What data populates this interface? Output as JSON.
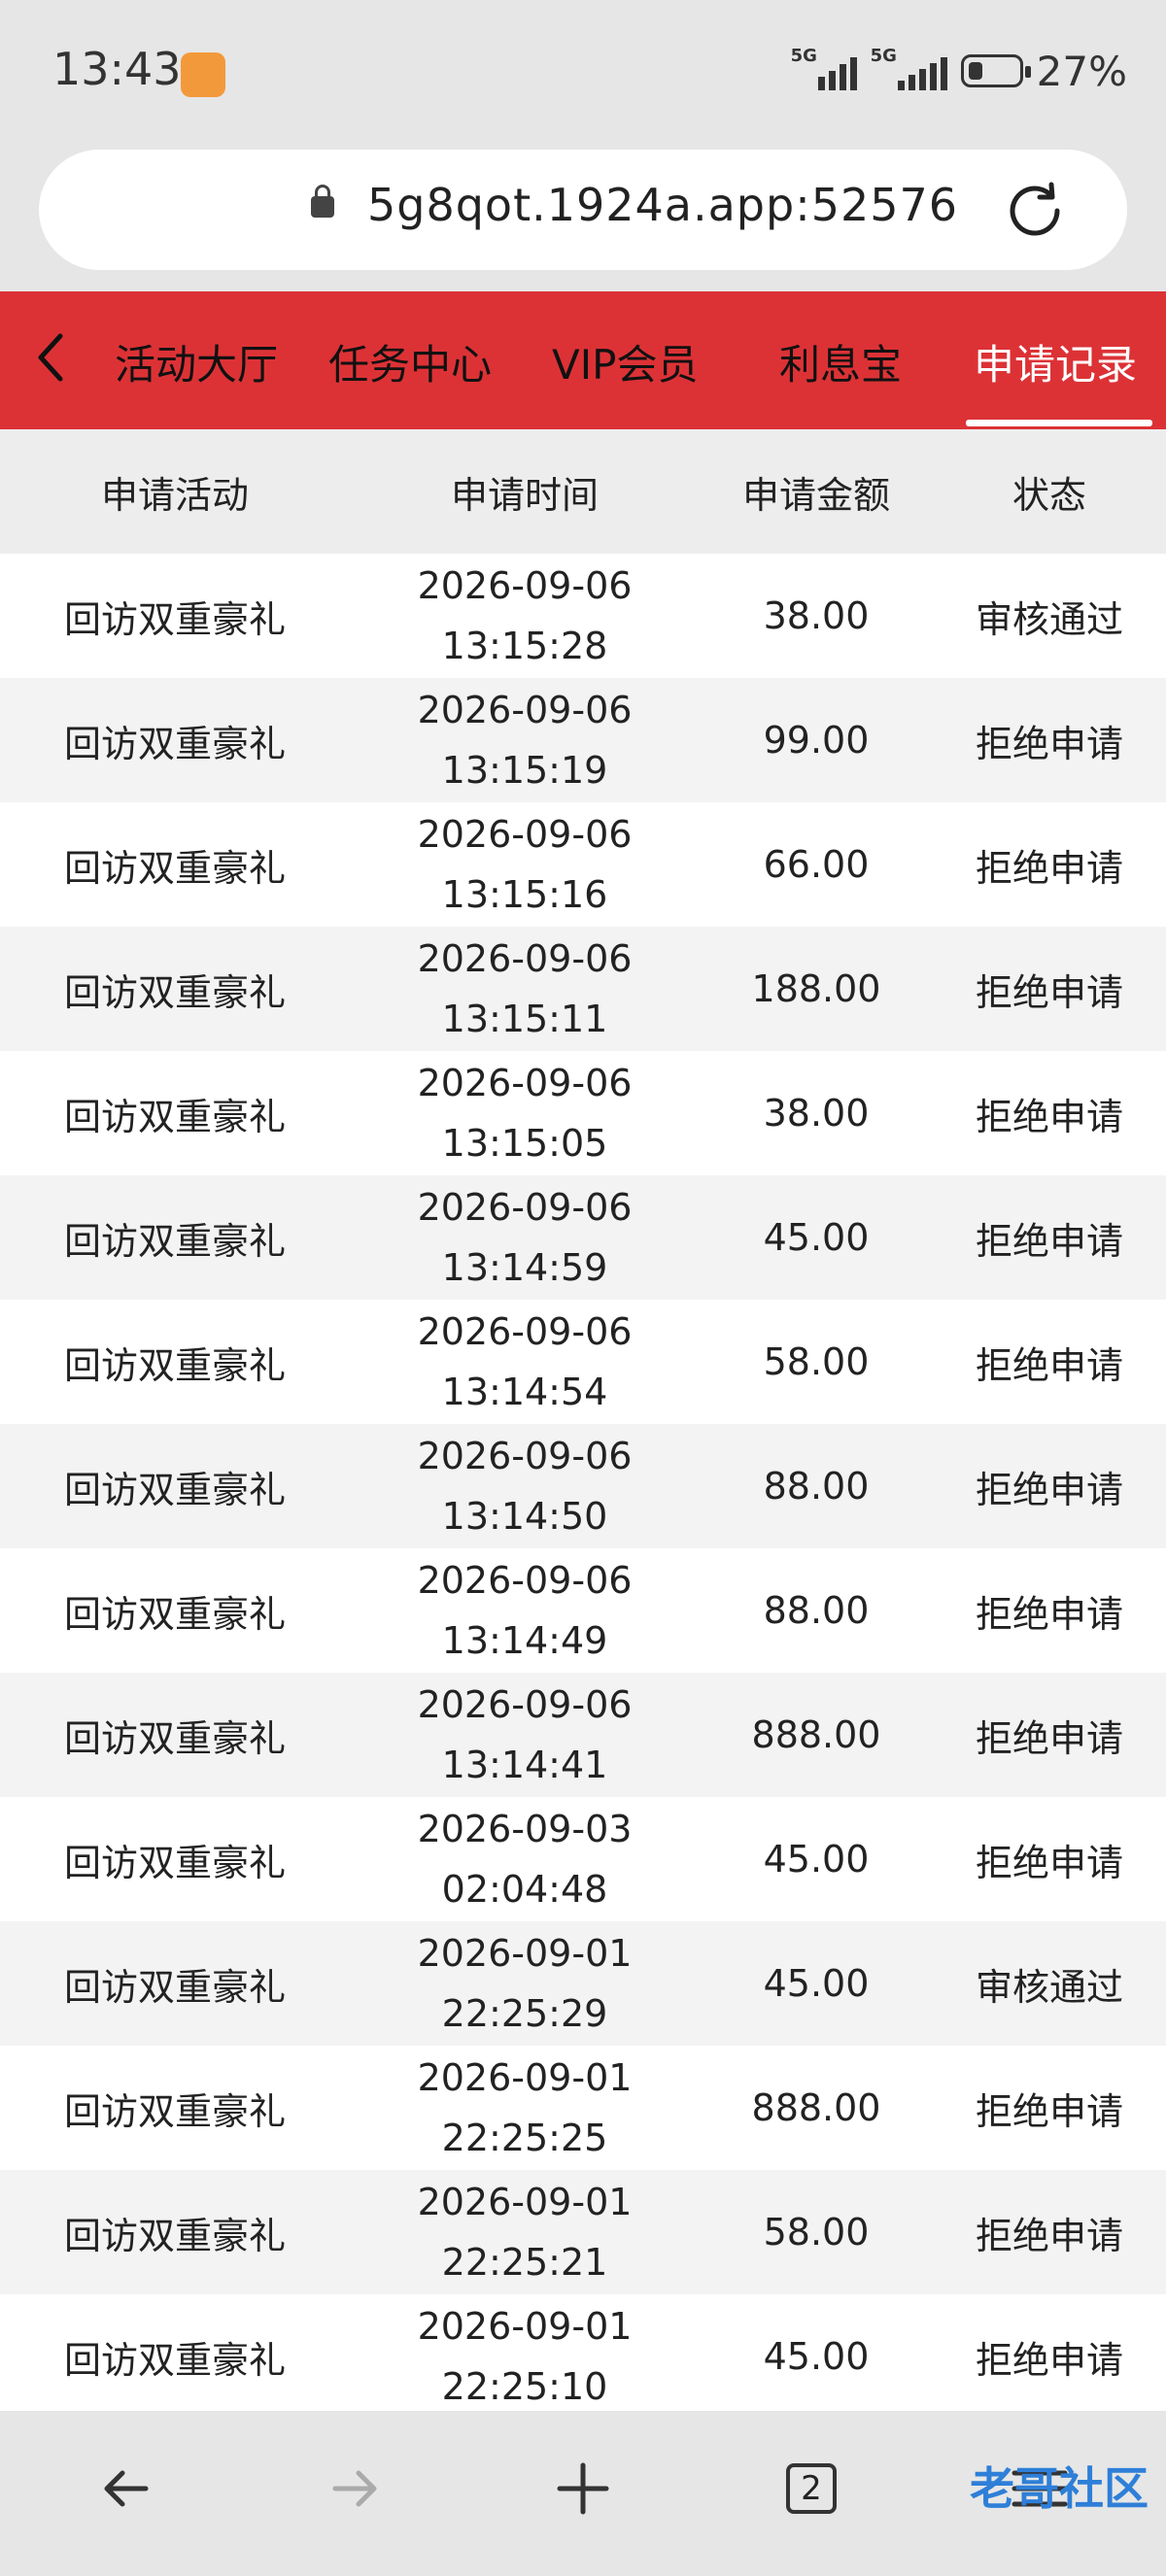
{
  "status_bar": {
    "time": "13:43",
    "signal_label": "5G",
    "battery": "27%"
  },
  "browser": {
    "url": "5g8qot.1924a.app:52576",
    "tabs_count": "2"
  },
  "nav": {
    "tabs": [
      {
        "label": "活动大厅"
      },
      {
        "label": "任务中心"
      },
      {
        "label": "VIP会员"
      },
      {
        "label": "利息宝"
      },
      {
        "label": "申请记录",
        "active": true
      }
    ]
  },
  "table": {
    "headers": [
      "申请活动",
      "申请时间",
      "申请金额",
      "状态"
    ],
    "rows": [
      {
        "activity": "回访双重豪礼",
        "date": "2026-09-06",
        "time": "13:15:28",
        "amount": "38.00",
        "status": "审核通过"
      },
      {
        "activity": "回访双重豪礼",
        "date": "2026-09-06",
        "time": "13:15:19",
        "amount": "99.00",
        "status": "拒绝申请"
      },
      {
        "activity": "回访双重豪礼",
        "date": "2026-09-06",
        "time": "13:15:16",
        "amount": "66.00",
        "status": "拒绝申请"
      },
      {
        "activity": "回访双重豪礼",
        "date": "2026-09-06",
        "time": "13:15:11",
        "amount": "188.00",
        "status": "拒绝申请"
      },
      {
        "activity": "回访双重豪礼",
        "date": "2026-09-06",
        "time": "13:15:05",
        "amount": "38.00",
        "status": "拒绝申请"
      },
      {
        "activity": "回访双重豪礼",
        "date": "2026-09-06",
        "time": "13:14:59",
        "amount": "45.00",
        "status": "拒绝申请"
      },
      {
        "activity": "回访双重豪礼",
        "date": "2026-09-06",
        "time": "13:14:54",
        "amount": "58.00",
        "status": "拒绝申请"
      },
      {
        "activity": "回访双重豪礼",
        "date": "2026-09-06",
        "time": "13:14:50",
        "amount": "88.00",
        "status": "拒绝申请"
      },
      {
        "activity": "回访双重豪礼",
        "date": "2026-09-06",
        "time": "13:14:49",
        "amount": "88.00",
        "status": "拒绝申请"
      },
      {
        "activity": "回访双重豪礼",
        "date": "2026-09-06",
        "time": "13:14:41",
        "amount": "888.00",
        "status": "拒绝申请"
      },
      {
        "activity": "回访双重豪礼",
        "date": "2026-09-03",
        "time": "02:04:48",
        "amount": "45.00",
        "status": "拒绝申请"
      },
      {
        "activity": "回访双重豪礼",
        "date": "2026-09-01",
        "time": "22:25:29",
        "amount": "45.00",
        "status": "审核通过"
      },
      {
        "activity": "回访双重豪礼",
        "date": "2026-09-01",
        "time": "22:25:25",
        "amount": "888.00",
        "status": "拒绝申请"
      },
      {
        "activity": "回访双重豪礼",
        "date": "2026-09-01",
        "time": "22:25:21",
        "amount": "58.00",
        "status": "拒绝申请"
      },
      {
        "activity": "回访双重豪礼",
        "date": "2026-09-01",
        "time": "22:25:10",
        "amount": "45.00",
        "status": "拒绝申请"
      }
    ]
  },
  "watermark": {
    "text": "老哥社区"
  },
  "colors": {
    "header_red": "#dc3236",
    "active_tab": "#ffffff"
  }
}
